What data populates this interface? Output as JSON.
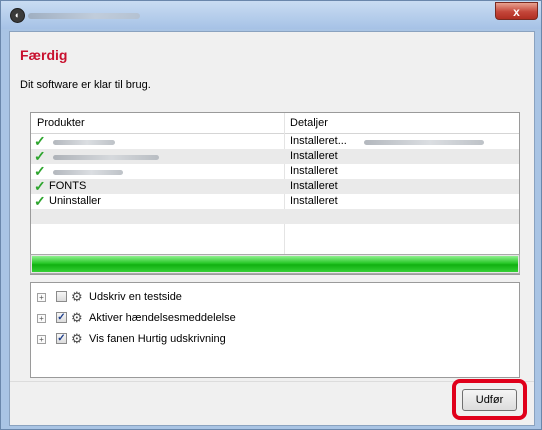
{
  "window": {
    "close_label": "x"
  },
  "header": {
    "title": "Færdig",
    "subtitle": "Dit software er klar til brug."
  },
  "table": {
    "columns": [
      "Produkter",
      "Detaljer"
    ],
    "rows": [
      {
        "name": "",
        "detail": "Installeret...",
        "status_icon": "checkmark-icon"
      },
      {
        "name": "",
        "detail": "Installeret",
        "status_icon": "checkmark-icon"
      },
      {
        "name": "",
        "detail": "Installeret",
        "status_icon": "checkmark-icon"
      },
      {
        "name": "FONTS",
        "detail": "Installeret",
        "status_icon": "checkmark-icon"
      },
      {
        "name": "Uninstaller",
        "detail": "Installeret",
        "status_icon": "checkmark-icon"
      }
    ]
  },
  "progress": {
    "percent": 100,
    "color": "#22c322"
  },
  "options": [
    {
      "label": "Udskriv en testside",
      "checked": false,
      "icon": "gear-icon"
    },
    {
      "label": "Aktiver hændelsesmeddelelse",
      "checked": true,
      "icon": "gear-icon"
    },
    {
      "label": "Vis fanen Hurtig udskrivning",
      "checked": true,
      "icon": "gear-icon"
    }
  ],
  "footer": {
    "finish_label": "Udfør",
    "highlight_color": "#e0001b"
  },
  "colors": {
    "heading": "#c8102e",
    "check": "#2ea52e"
  }
}
